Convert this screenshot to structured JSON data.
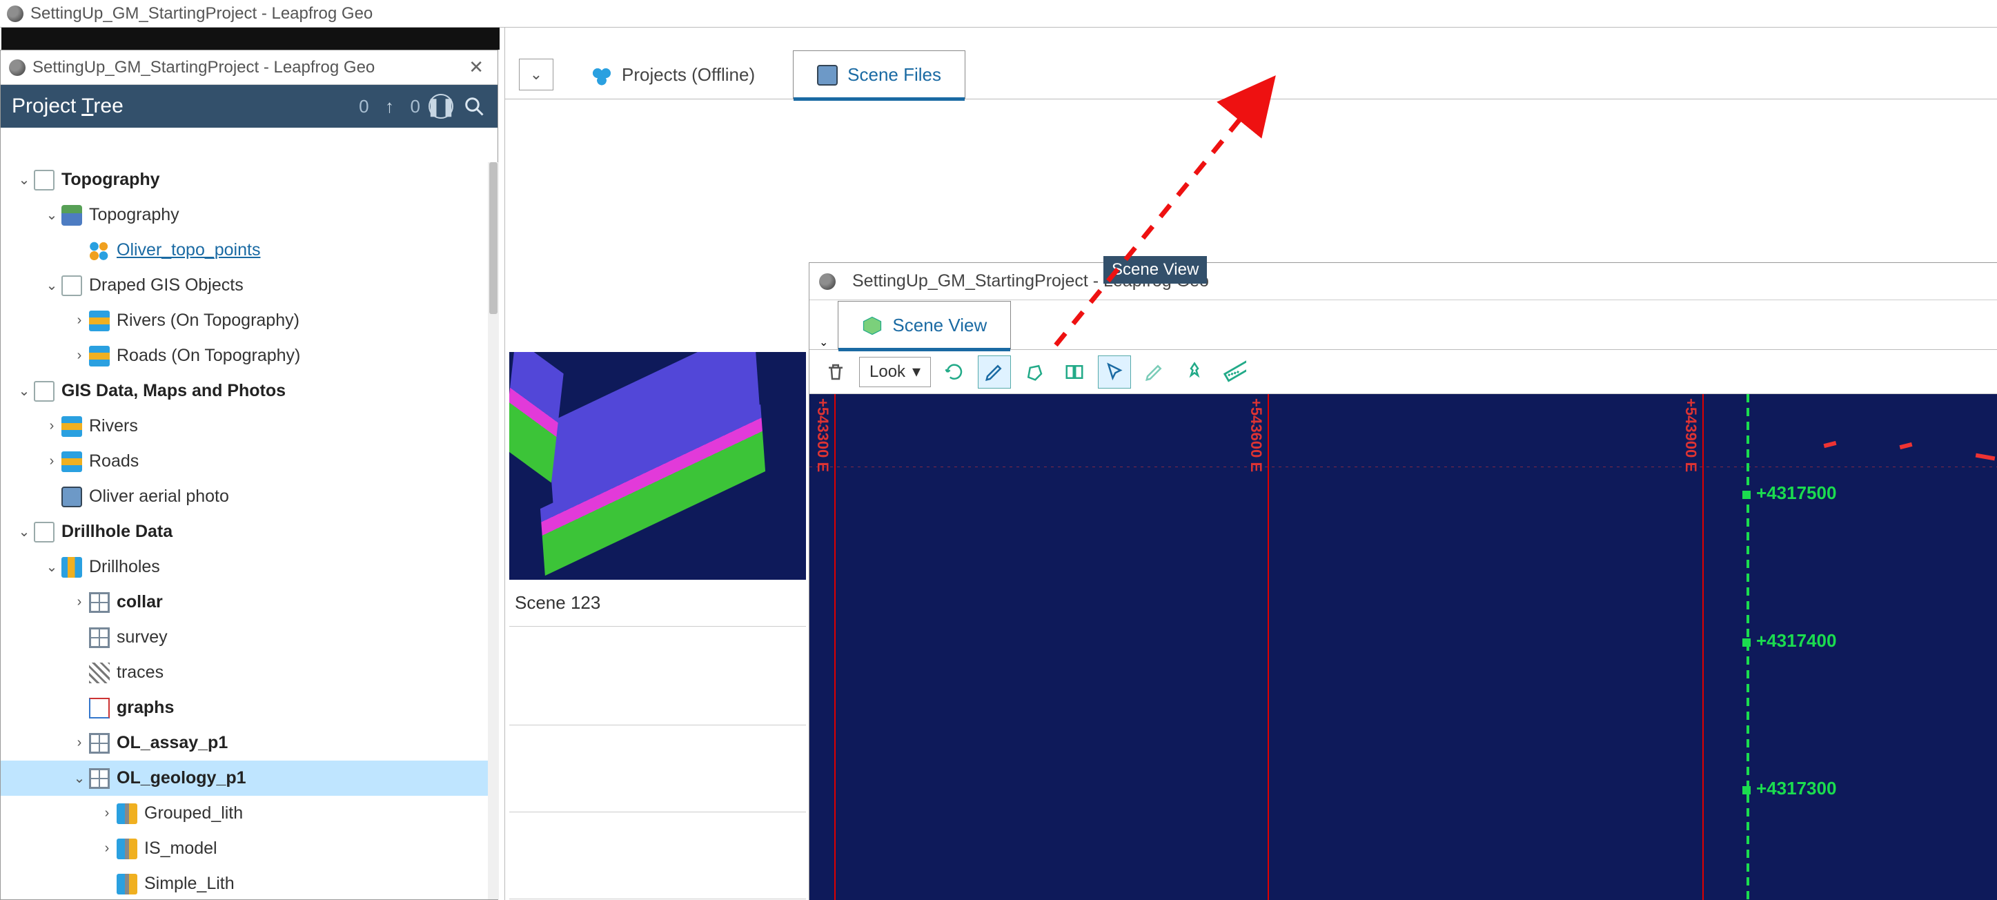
{
  "app": {
    "title": "SettingUp_GM_StartingProject - Leapfrog Geo"
  },
  "float": {
    "title": "SettingUp_GM_StartingProject - Leapfrog Geo",
    "tab_label": "Scene View",
    "look_label": "Look",
    "tooltip": "Scene View"
  },
  "projectTree": {
    "header": "Project Tree",
    "header_prefix": "Project ",
    "header_mnemonic": "T",
    "header_suffix": "ree",
    "count_a": "0",
    "count_b": "0"
  },
  "tabs": {
    "projects": "Projects (Offline)",
    "scene_files": "Scene Files"
  },
  "sceneCard": {
    "caption": "Scene 123"
  },
  "viewport": {
    "v_lines": [
      "+543300 E",
      "+543600 E",
      "+543900 E"
    ],
    "e_labels": [
      "+4317500",
      "+4317400",
      "+4317300"
    ]
  },
  "tree": [
    {
      "indent": 0,
      "toggle": "down",
      "icon": "folder",
      "label": "Topography",
      "bold": true
    },
    {
      "indent": 1,
      "toggle": "down",
      "icon": "topo",
      "label": "Topography"
    },
    {
      "indent": 2,
      "toggle": "",
      "icon": "dots",
      "label": "Oliver_topo_points",
      "link": true
    },
    {
      "indent": 1,
      "toggle": "down",
      "icon": "folder",
      "label": "Draped GIS Objects"
    },
    {
      "indent": 2,
      "toggle": "right",
      "icon": "layer",
      "label": "Rivers (On Topography)"
    },
    {
      "indent": 2,
      "toggle": "right",
      "icon": "layer",
      "label": "Roads (On Topography)"
    },
    {
      "indent": 0,
      "toggle": "down",
      "icon": "folder",
      "label": "GIS Data, Maps and Photos",
      "bold": true
    },
    {
      "indent": 1,
      "toggle": "right",
      "icon": "layer",
      "label": "Rivers"
    },
    {
      "indent": 1,
      "toggle": "right",
      "icon": "layer",
      "label": "Roads"
    },
    {
      "indent": 1,
      "toggle": "",
      "icon": "photo",
      "label": "Oliver aerial photo"
    },
    {
      "indent": 0,
      "toggle": "down",
      "icon": "folder",
      "label": "Drillhole Data",
      "bold": true
    },
    {
      "indent": 1,
      "toggle": "down",
      "icon": "drill",
      "label": "Drillholes"
    },
    {
      "indent": 2,
      "toggle": "right",
      "icon": "table",
      "label": "collar",
      "bold": true
    },
    {
      "indent": 2,
      "toggle": "",
      "icon": "table",
      "label": "survey"
    },
    {
      "indent": 2,
      "toggle": "",
      "icon": "traces",
      "label": "traces"
    },
    {
      "indent": 2,
      "toggle": "",
      "icon": "graphs",
      "label": "graphs",
      "bold": true
    },
    {
      "indent": 2,
      "toggle": "right",
      "icon": "table",
      "label": "OL_assay_p1",
      "bold": true
    },
    {
      "indent": 2,
      "toggle": "down",
      "icon": "table",
      "label": "OL_geology_p1",
      "bold": true,
      "selected": true
    },
    {
      "indent": 3,
      "toggle": "right",
      "icon": "grouped",
      "label": "Grouped_lith"
    },
    {
      "indent": 3,
      "toggle": "right",
      "icon": "grouped",
      "label": "IS_model"
    },
    {
      "indent": 3,
      "toggle": "",
      "icon": "grouped",
      "label": "Simple_Lith"
    }
  ]
}
